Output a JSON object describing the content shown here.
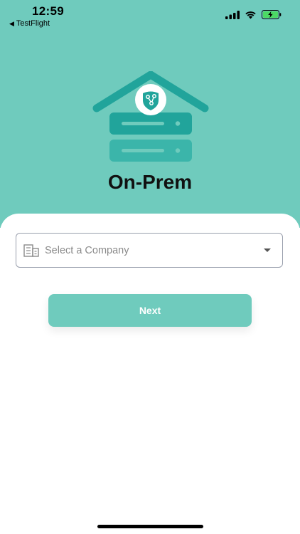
{
  "status_bar": {
    "time": "12:59",
    "back_app": "TestFlight",
    "back_arrow": "◀",
    "icons": [
      "signal-icon",
      "wifi-icon",
      "battery-charging-icon"
    ]
  },
  "header": {
    "title": "On-Prem",
    "logo": "server-house-icon"
  },
  "form": {
    "company_select": {
      "placeholder": "Select a Company",
      "icon": "building-icon"
    },
    "next_label": "Next"
  },
  "colors": {
    "accent": "#6fcbbd",
    "logo_dark": "#21a49b",
    "logo_light": "#3bb5aa",
    "battery": "#4cd964"
  }
}
